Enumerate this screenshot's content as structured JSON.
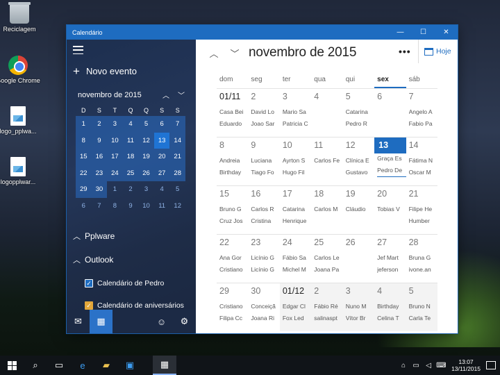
{
  "desktop": {
    "icons": [
      {
        "label": "Reciclagem",
        "icon": "recycle-bin-icon"
      },
      {
        "label": "Google Chrome",
        "icon": "chrome-icon"
      },
      {
        "label": "logo_pplwa...",
        "icon": "image-file-icon"
      },
      {
        "label": "logopplwar...",
        "icon": "image-file-icon"
      }
    ]
  },
  "window": {
    "title": "Calendário",
    "controls": {
      "minimize": "—",
      "maximize": "☐",
      "close": "✕"
    }
  },
  "sidebar": {
    "new_event": "Novo evento",
    "mini_calendar": {
      "month_label": "novembro de 2015",
      "weekdays": [
        "D",
        "S",
        "T",
        "Q",
        "Q",
        "S",
        "S"
      ],
      "days": [
        [
          "1",
          "2",
          "3",
          "4",
          "5",
          "6",
          "7"
        ],
        [
          "8",
          "9",
          "10",
          "11",
          "12",
          "13",
          "14"
        ],
        [
          "15",
          "16",
          "17",
          "18",
          "19",
          "20",
          "21"
        ],
        [
          "22",
          "23",
          "24",
          "25",
          "26",
          "27",
          "28"
        ],
        [
          "29",
          "30",
          "1",
          "2",
          "3",
          "4",
          "5"
        ],
        [
          "6",
          "7",
          "8",
          "9",
          "10",
          "11",
          "12"
        ]
      ],
      "today": "13"
    },
    "sections": {
      "pplware": "Pplware",
      "outlook": "Outlook"
    },
    "calendars": [
      {
        "label": "Calendário de Pedro",
        "color": "#1e6cc0"
      },
      {
        "label": "Calendário de aniversários",
        "color": "#e3a73a"
      }
    ]
  },
  "main": {
    "title": "novembro de 2015",
    "more": "•••",
    "today_button": "Hoje",
    "weekdays": [
      "dom",
      "seg",
      "ter",
      "qua",
      "qui",
      "sex",
      "sáb"
    ],
    "selected_weekday": "sex",
    "weeks": [
      [
        {
          "d": "01/11",
          "ev": [
            "Casa Bei",
            "Eduardo"
          ],
          "first": true
        },
        {
          "d": "2",
          "ev": [
            "David Lo",
            "Joao Sar"
          ]
        },
        {
          "d": "3",
          "ev": [
            "Mario Sa",
            "Patricia C"
          ]
        },
        {
          "d": "4",
          "ev": []
        },
        {
          "d": "5",
          "ev": [
            "Catarina",
            "Pedro R"
          ]
        },
        {
          "d": "6",
          "ev": []
        },
        {
          "d": "7",
          "ev": [
            "Angelo A",
            "Fabio Pa"
          ]
        }
      ],
      [
        {
          "d": "8",
          "ev": [
            "Andreia",
            "Birthday"
          ]
        },
        {
          "d": "9",
          "ev": [
            "Luciana",
            "Tiago Fo"
          ]
        },
        {
          "d": "10",
          "ev": [
            "Ayrton S",
            "Hugo Fil"
          ]
        },
        {
          "d": "11",
          "ev": [
            "Carlos Fe"
          ]
        },
        {
          "d": "12",
          "ev": [
            "Clínica E",
            "Gustavo"
          ]
        },
        {
          "d": "13",
          "ev": [
            "Graça Es",
            "Pedro De"
          ],
          "today": true
        },
        {
          "d": "14",
          "ev": [
            "Fátima N",
            "Oscar M"
          ]
        }
      ],
      [
        {
          "d": "15",
          "ev": [
            "Bruno G",
            "Cruz Jos"
          ]
        },
        {
          "d": "16",
          "ev": [
            "Carlos R",
            "Cristina"
          ]
        },
        {
          "d": "17",
          "ev": [
            "Catarina",
            "Henrique"
          ]
        },
        {
          "d": "18",
          "ev": [
            "Carlos M"
          ]
        },
        {
          "d": "19",
          "ev": [
            "Cláudio"
          ]
        },
        {
          "d": "20",
          "ev": [
            "Tobias V"
          ]
        },
        {
          "d": "21",
          "ev": [
            "Filipe He",
            "Humber"
          ]
        }
      ],
      [
        {
          "d": "22",
          "ev": [
            "Ana Gor",
            "Cristiano"
          ]
        },
        {
          "d": "23",
          "ev": [
            "Licínio G",
            "Licínio G"
          ]
        },
        {
          "d": "24",
          "ev": [
            "Fábio Sa",
            "Michel M"
          ]
        },
        {
          "d": "25",
          "ev": [
            "Carlos Le",
            "Joana Pa"
          ]
        },
        {
          "d": "26",
          "ev": []
        },
        {
          "d": "27",
          "ev": [
            "Jef Mart",
            "jeferson"
          ]
        },
        {
          "d": "28",
          "ev": [
            "Bruna G",
            "ivone.an"
          ]
        }
      ],
      [
        {
          "d": "29",
          "ev": [
            "Cristiano",
            "Filipa Cc"
          ]
        },
        {
          "d": "30",
          "ev": [
            "Conceiçã",
            "Joana Ri"
          ]
        },
        {
          "d": "01/12",
          "ev": [
            "Edgar Cl",
            "Fox Led"
          ],
          "first": true,
          "other": true
        },
        {
          "d": "2",
          "ev": [
            "Fábio Ré",
            "salinaspt"
          ],
          "other": true
        },
        {
          "d": "3",
          "ev": [
            "Nuno M",
            "Vítor Br"
          ],
          "other": true
        },
        {
          "d": "4",
          "ev": [
            "Birthday",
            "Celina T"
          ],
          "other": true
        },
        {
          "d": "5",
          "ev": [
            "Bruno N",
            "Carla Te"
          ],
          "other": true
        }
      ]
    ]
  },
  "taskbar": {
    "clock_time": "13:07",
    "clock_date": "13/11/2015"
  }
}
